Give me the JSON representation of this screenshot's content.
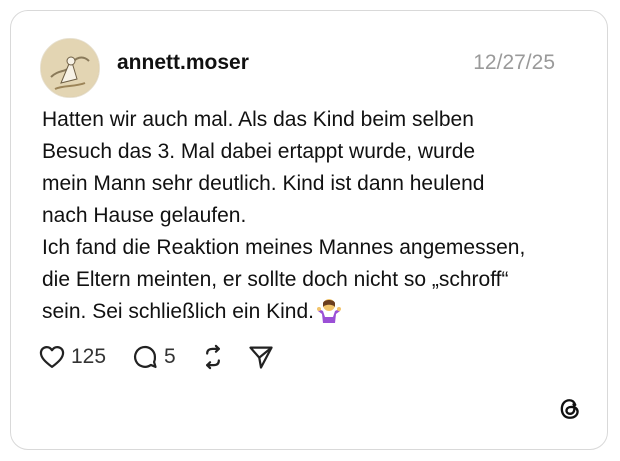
{
  "post": {
    "username": "annett.moser",
    "date": "12/27/25",
    "lines": [
      "Hatten wir auch mal. Als das Kind beim selben",
      "Besuch das 3. Mal dabei ertappt wurde, wurde",
      "mein Mann sehr deutlich. Kind ist dann heulend",
      "nach Hause gelaufen.",
      "Ich fand die Reaktion meines Mannes angemessen,",
      "die Eltern meinten, er sollte doch nicht so „schroff“",
      "sein. Sei schließlich ein Kind."
    ],
    "emoji": "person-shrugging-emoji"
  },
  "actions": {
    "like": {
      "icon": "heart-icon",
      "count": "125"
    },
    "reply": {
      "icon": "comment-icon",
      "count": "5"
    },
    "repost": {
      "icon": "repost-icon"
    },
    "share": {
      "icon": "send-icon"
    }
  },
  "brand": {
    "icon": "threads-logo-icon"
  },
  "colors": {
    "text": "#111111",
    "muted": "#9a9a9a",
    "border": "#d9d9d9",
    "emoji": "#9b4fd6"
  }
}
